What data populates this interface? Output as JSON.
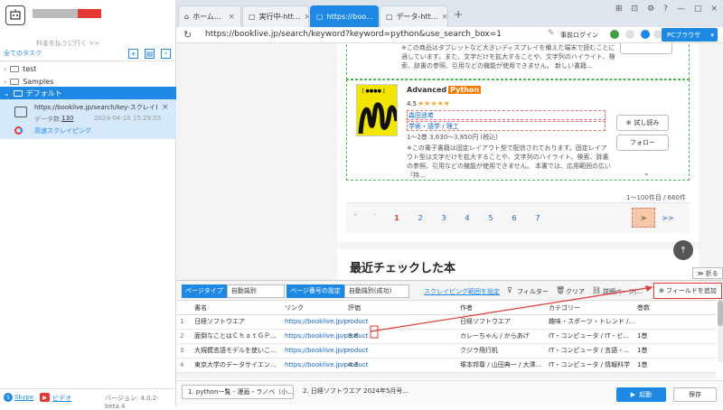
{
  "sidebar": {
    "username": "●●●●●",
    "pay_link": "料金を払うに行く >>",
    "all_tasks": "全てのタスク",
    "folders": [
      {
        "name": "test",
        "expanded": false
      },
      {
        "name": "Samples",
        "expanded": false
      },
      {
        "name": "デフォルト",
        "expanded": true
      }
    ],
    "task": {
      "url": "https://booklive.jp/search/key-スクレイピン...",
      "data_label": "データ数:",
      "data_count": "130",
      "datetime": "2024-04-16 15:29:55",
      "mode": "高速スクレイピング"
    },
    "footer": {
      "skype": "Skype",
      "video": "ビデオ",
      "version": "バージョン: 4.0.2-beta.4"
    }
  },
  "tabs": [
    {
      "label": "ホーム...",
      "active": false
    },
    {
      "label": "実行中-htt...",
      "active": false
    },
    {
      "label": "https://boo...",
      "active": true
    },
    {
      "label": "データ-htt...",
      "active": false
    }
  ],
  "address": {
    "url": "https://booklive.jp/search/keyword?keyword=python&use_search_box=1",
    "pre_login": "事前ログイン",
    "browser_mode": "PCブラウザ"
  },
  "page": {
    "top_desc": "※この商品はタブレットなど大きいディスプレイを備えた端末で読むことに適しています。また、文字だけを拡大することや、文字列のハイライト、検索、辞書の参照、引用などの機能が使用できません。 新しい書籍...",
    "book": {
      "title": "Advanced",
      "title_tag": "Python",
      "rating": "4.5",
      "stars": "★★★★★",
      "publisher": "森田遥希",
      "category": "学術・語学 / 理工",
      "vols": "1〜2巻 3,630〜3,850円 (税込)",
      "desc": "※この電子書籍は固定レイアウト型で配信されております。固定レイアウト型は文字だけを拡大することや、文字列のハイライト、検索、辞書の参照、引用などの機能が使用できません。 本書では、応用範囲の広い『持...",
      "cover_text": "[ ●●●● ]",
      "trial": "試し読み",
      "follow": "フォロー"
    },
    "result_count": "1〜100件目 / 660件",
    "pages": [
      "1",
      "2",
      "3",
      "4",
      "5",
      "6",
      "7"
    ],
    "next": ">",
    "last": ">>",
    "recent_title": "最近チェックした本",
    "collapse": "折る"
  },
  "toolbar": {
    "page_type_label": "ページタイプ",
    "page_type_value": "自動識別",
    "page_num_label": "ページ番号の設定",
    "page_num_value": "自動識別(成功)",
    "scrape_range": "スクレイピング範囲を設定",
    "filter": "フィルター",
    "clear": "クリア",
    "detail": "詳細ページ(...",
    "add_field": "フィールドを追加"
  },
  "table": {
    "headers": [
      "書名",
      "リンク",
      "評価",
      "作者",
      "カテゴリー",
      "巻数"
    ],
    "rows": [
      {
        "n": "1",
        "c": [
          "日経ソフトウエア",
          "https://booklive.jp/product/in...",
          "-",
          "日経ソフトウエア",
          "趣味・スポーツ・トレンド /...",
          ""
        ]
      },
      {
        "n": "2",
        "c": [
          "面倒なことはＣｈａｔＧＰ...",
          "https://booklive.jp/product/in...",
          "3.8",
          "カレーちゃん / からあげ",
          "IT・コンピュータ / IT・ビ...",
          "1巻"
        ]
      },
      {
        "n": "3",
        "c": [
          "大規模言語モデルを使いこ...",
          "https://booklive.jp/product/in...",
          "-",
          "クジラ飛行机",
          "IT・コンピュータ / 言語・...",
          "1巻"
        ]
      },
      {
        "n": "4",
        "c": [
          "東京大学のデータサイエン...",
          "https://booklive.jp/product/in...",
          "4.3",
          "塚本邦尊 / 山田典一 / 大澤...",
          "IT・コンピュータ / 情報科学",
          "1巻"
        ]
      }
    ]
  },
  "bottom_tabs": [
    "1. python一覧 - 漫画・ラノベ（小...",
    "2. 日経ソフトウエア 2024年5月号..."
  ],
  "actions": {
    "start": "起動",
    "save": "保存"
  },
  "colors": {
    "accent": "#1e88e5",
    "highlight": "#e53935",
    "orange_tag": "#f57c00",
    "green_border": "#4caf50"
  }
}
